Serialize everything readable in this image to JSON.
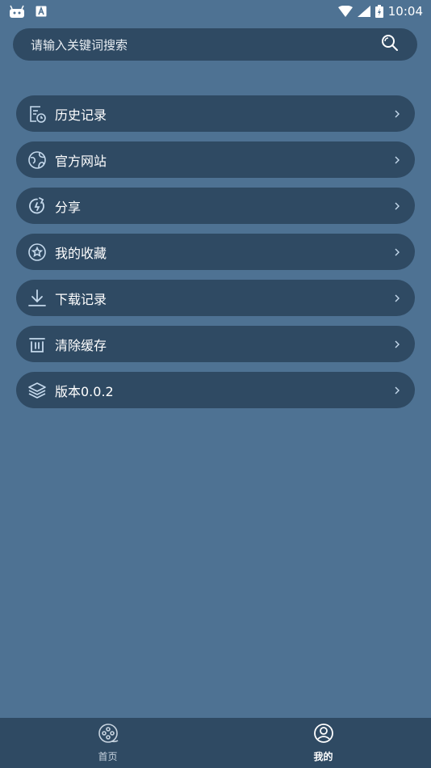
{
  "status_bar": {
    "time": "10:04",
    "left_icons": [
      "android-robot-icon",
      "notification-a-icon"
    ],
    "right_icons": [
      "wifi-icon",
      "signal-icon",
      "battery-charging-icon"
    ]
  },
  "search": {
    "placeholder": "请输入关键词搜索",
    "icon": "search-icon"
  },
  "menu": {
    "items": [
      {
        "label": "历史记录",
        "icon": "history-icon"
      },
      {
        "label": "官方网站",
        "icon": "globe-icon"
      },
      {
        "label": "分享",
        "icon": "share-icon"
      },
      {
        "label": "我的收藏",
        "icon": "star-icon"
      },
      {
        "label": "下载记录",
        "icon": "download-icon"
      },
      {
        "label": "清除缓存",
        "icon": "trash-icon"
      },
      {
        "label": "版本0.0.2",
        "icon": "layers-icon"
      }
    ]
  },
  "bottom_nav": {
    "tabs": [
      {
        "label": "首页",
        "icon": "film-reel-icon",
        "active": false
      },
      {
        "label": "我的",
        "icon": "user-icon",
        "active": true
      }
    ]
  },
  "colors": {
    "background": "#4e7293",
    "surface": "#2f4a63",
    "text": "#ffffff",
    "icon": "#c5d9ec"
  }
}
